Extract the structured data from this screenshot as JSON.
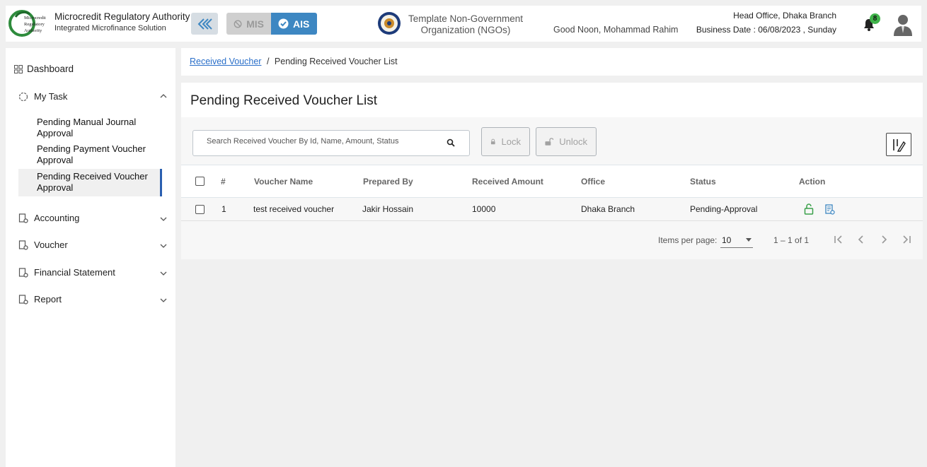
{
  "header": {
    "brand_title": "Microcredit Regulatory Authority",
    "brand_subtitle": "Integrated Microfinance Solution",
    "logo_text": [
      "Microcredit",
      "Regulatory",
      "Authority"
    ],
    "mode_mis": "MIS",
    "mode_ais": "AIS",
    "org_name": "Template Non-Government Organization (NGOs)",
    "greeting": "Good Noon, Mohammad Rahim",
    "office": "Head Office, Dhaka Branch",
    "business_date": "Business Date : 06/08/2023 , Sunday",
    "notification_count": "8"
  },
  "sidebar": {
    "dashboard": "Dashboard",
    "my_task": "My Task",
    "sub_items": [
      "Pending Manual Journal Approval",
      "Pending Payment Voucher Approval",
      "Pending Received Voucher Approval"
    ],
    "sections": [
      "Accounting",
      "Voucher",
      "Financial Statement",
      "Report"
    ]
  },
  "breadcrumb": {
    "link": "Received Voucher",
    "separator": "/",
    "current": "Pending Received Voucher List"
  },
  "main": {
    "title": "Pending Received Voucher List",
    "search_placeholder": "Search Received Voucher By Id, Name, Amount, Status",
    "lock_label": "Lock",
    "unlock_label": "Unlock"
  },
  "table": {
    "columns": [
      "#",
      "Voucher Name",
      "Prepared By",
      "Received Amount",
      "Office",
      "Status",
      "Action"
    ],
    "rows": [
      {
        "no": "1",
        "voucher_name": "test received voucher",
        "prepared_by": "Jakir Hossain",
        "amount": "10000",
        "office": "Dhaka Branch",
        "status": "Pending-Approval"
      }
    ]
  },
  "paginator": {
    "items_per_page_label": "Items per page:",
    "page_size": "10",
    "range": "1 – 1 of 1"
  },
  "colors": {
    "accent": "#3d87c2",
    "active_bar": "#2a5fb0",
    "badge": "#3fb34a",
    "lock_icon": "#3aa04a",
    "doc_icon": "#3d87c2"
  }
}
